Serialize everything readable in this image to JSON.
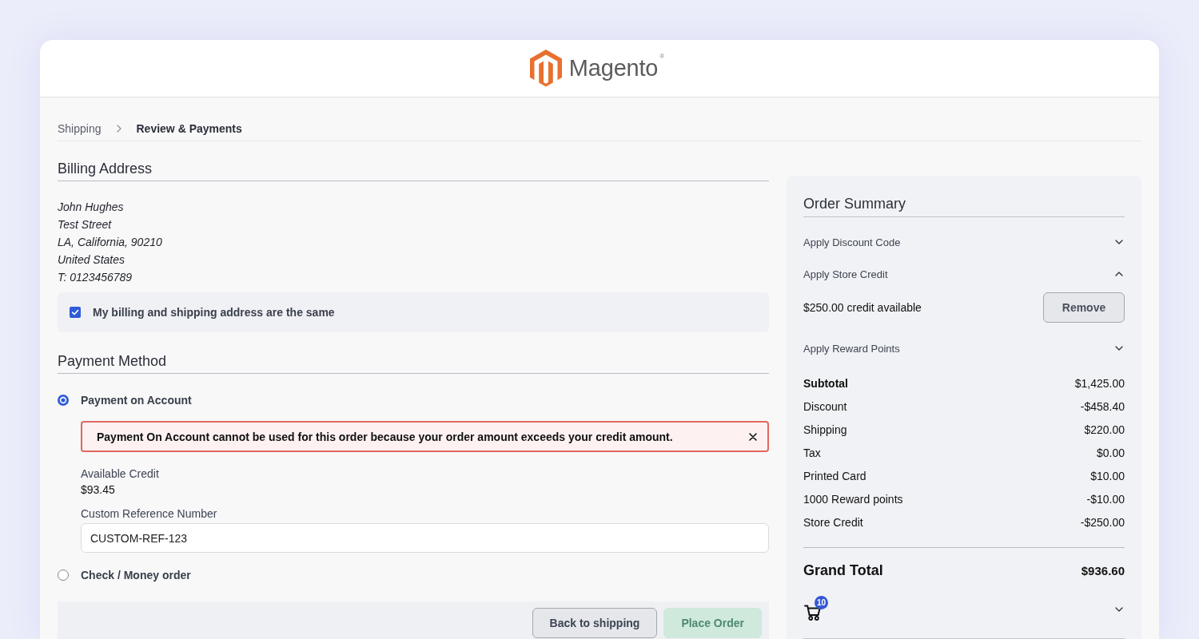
{
  "header": {
    "logo_text": "Magento",
    "logo_mark": "®"
  },
  "breadcrumb": [
    {
      "label": "Shipping",
      "selected": false
    },
    {
      "label": "Review & Payments",
      "selected": true
    }
  ],
  "billing": {
    "title": "Billing Address",
    "address": [
      "John Hughes",
      "Test Street",
      "LA, California, 90210",
      "United States",
      "T: 0123456789"
    ],
    "same_address": {
      "label": "My billing and shipping address are the same",
      "checked": true
    }
  },
  "payment": {
    "title": "Payment Method",
    "methods": [
      {
        "label": "Payment on Account",
        "selected": true,
        "error": "Payment On Account cannot be used for this order because your order amount exceeds your credit amount.",
        "credit_label": "Available Credit",
        "credit_value": "$93.45",
        "reference": {
          "label": "Custom Reference Number",
          "value": "CUSTOM-REF-123"
        }
      },
      {
        "label": "Check / Money order",
        "selected": false
      }
    ]
  },
  "actions": [
    {
      "label": "Back to shipping",
      "kind": "secondary",
      "disabled": false
    },
    {
      "label": "Place Order",
      "kind": "primary",
      "disabled": true
    }
  ],
  "summary": {
    "title": "Order Summary",
    "sections": [
      {
        "label": "Apply Discount Code",
        "expanded": false
      },
      {
        "label": "Apply Store Credit",
        "expanded": true,
        "content": {
          "text": "$250.00 credit available",
          "button": "Remove"
        }
      },
      {
        "label": "Apply Reward Points",
        "expanded": false
      }
    ],
    "totals": [
      {
        "label": "Subtotal",
        "value": "$1,425.00",
        "kind": "subtotal"
      },
      {
        "label": "Discount",
        "value": "-$458.40",
        "kind": "line"
      },
      {
        "label": "Shipping",
        "value": "$220.00",
        "kind": "line"
      },
      {
        "label": "Tax",
        "value": "$0.00",
        "kind": "line"
      },
      {
        "label": "Printed Card",
        "value": "$10.00",
        "kind": "line"
      },
      {
        "label": "1000 Reward points",
        "value": "-$10.00",
        "kind": "line"
      },
      {
        "label": "Store Credit",
        "value": "-$250.00",
        "kind": "line"
      }
    ],
    "grand_total": {
      "label": "Grand Total",
      "value": "$936.60"
    },
    "cart": {
      "count": "10",
      "expanded": false
    }
  }
}
